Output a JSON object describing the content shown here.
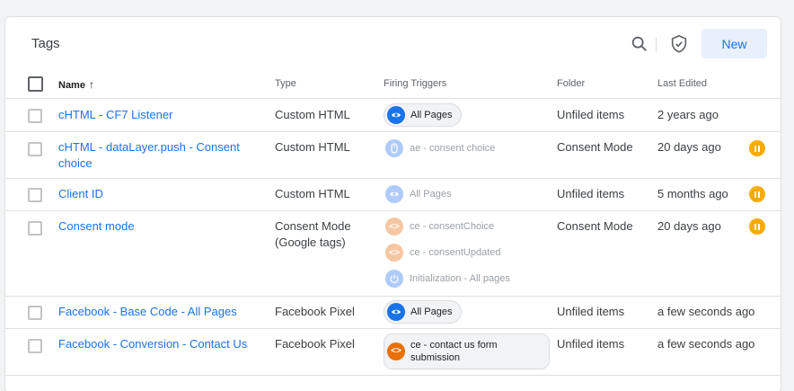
{
  "panel": {
    "title": "Tags",
    "new_label": "New"
  },
  "columns": {
    "name": "Name",
    "type": "Type",
    "triggers": "Firing Triggers",
    "folder": "Folder",
    "edited": "Last Edited",
    "sort_glyph": "↑"
  },
  "rows": [
    {
      "name": "cHTML - CF7 Listener",
      "type": "Custom HTML",
      "triggers": [
        {
          "label": "All Pages",
          "icon": "eye-icon",
          "active": true
        }
      ],
      "folder": "Unfiled items",
      "edited": "2 years ago",
      "paused": false
    },
    {
      "name": "cHTML - dataLayer.push - Consent choice",
      "type": "Custom HTML",
      "triggers": [
        {
          "label": "ae - consent choice",
          "icon": "mouse-icon",
          "active": false
        }
      ],
      "folder": "Consent Mode",
      "edited": "20 days ago",
      "paused": true
    },
    {
      "name": "Client ID",
      "type": "Custom HTML",
      "triggers": [
        {
          "label": "All Pages",
          "icon": "eye-icon",
          "active": false
        }
      ],
      "folder": "Unfiled items",
      "edited": "5 months ago",
      "paused": true
    },
    {
      "name": "Consent mode",
      "type": "Consent Mode (Google tags)",
      "triggers": [
        {
          "label": "ce - consentChoice",
          "icon": "code-icon",
          "active": false
        },
        {
          "label": "ce - consentUpdated",
          "icon": "code-icon",
          "active": false
        },
        {
          "label": "Initialization - All pages",
          "icon": "power-icon",
          "active": false
        }
      ],
      "folder": "Consent Mode",
      "edited": "20 days ago",
      "paused": true
    },
    {
      "name": "Facebook - Base Code - All Pages",
      "type": "Facebook Pixel",
      "triggers": [
        {
          "label": "All Pages",
          "icon": "eye-icon",
          "active": true
        }
      ],
      "folder": "Unfiled items",
      "edited": "a few seconds ago",
      "paused": false
    },
    {
      "name": "Facebook - Conversion - Contact Us",
      "type": "Facebook Pixel",
      "triggers": [
        {
          "label": "ce - contact us form submission",
          "icon": "code-icon",
          "active": true
        }
      ],
      "folder": "Unfiled items",
      "edited": "a few seconds ago",
      "paused": false
    }
  ],
  "colors": {
    "accent": "#1a73e8",
    "paused": "#f9ab00",
    "custom_event": "#e8710a"
  }
}
